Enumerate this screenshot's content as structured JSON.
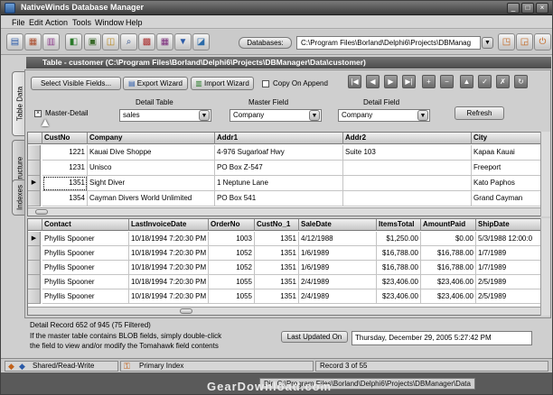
{
  "window": {
    "title": "NativeWinds Database Manager"
  },
  "menu": [
    "File",
    "Edit",
    "Action",
    "Tools",
    "Window",
    "Help"
  ],
  "toolbar": {
    "databases_label": "Databases:",
    "database_path": "C:\\Program Files\\Borland\\Delphi6\\Projects\\DBManag"
  },
  "table_title": "Table - customer (C:\\Program Files\\Borland\\Delphi6\\Projects\\DBManager\\Data\\customer)",
  "side_tabs": [
    "Table Data",
    "Structure",
    "Indexes"
  ],
  "controls": {
    "select_visible_fields": "Select Visible Fields...",
    "export_wizard": "Export Wizard",
    "import_wizard": "Import Wizard",
    "copy_on_append": "Copy On Append",
    "master_detail": "Master-Detail",
    "detail_table_label": "Detail Table",
    "detail_table_value": "sales",
    "master_field_label": "Master Field",
    "master_field_value": "Company",
    "detail_field_label": "Detail Field",
    "detail_field_value": "Company",
    "refresh": "Refresh"
  },
  "master_grid": {
    "columns": [
      "CustNo",
      "Company",
      "Addr1",
      "Addr2",
      "City"
    ],
    "rows": [
      [
        "1221",
        "Kauai Dive Shoppe",
        "4-976 Sugarloaf Hwy",
        "Suite 103",
        "Kapaa Kauai"
      ],
      [
        "1231",
        "Unisco",
        "PO Box Z-547",
        "",
        "Freeport"
      ],
      [
        "1351",
        "Sight Diver",
        "1 Neptune Lane",
        "",
        "Kato Paphos"
      ],
      [
        "1354",
        "Cayman Divers World Unlimited",
        "PO Box 541",
        "",
        "Grand Cayman"
      ]
    ]
  },
  "detail_grid": {
    "columns": [
      "Contact",
      "LastInvoiceDate",
      "OrderNo",
      "CustNo_1",
      "SaleDate",
      "ItemsTotal",
      "AmountPaid",
      "ShipDate"
    ],
    "rows": [
      [
        "Phyllis Spooner",
        "10/18/1994 7:20:30 PM",
        "1003",
        "1351",
        "4/12/1988",
        "$1,250.00",
        "$0.00",
        "5/3/1988 12:00:0"
      ],
      [
        "Phyllis Spooner",
        "10/18/1994 7:20:30 PM",
        "1052",
        "1351",
        "1/6/1989",
        "$16,788.00",
        "$16,788.00",
        "1/7/1989"
      ],
      [
        "Phyllis Spooner",
        "10/18/1994 7:20:30 PM",
        "1052",
        "1351",
        "1/6/1989",
        "$16,788.00",
        "$16,788.00",
        "1/7/1989"
      ],
      [
        "Phyllis Spooner",
        "10/18/1994 7:20:30 PM",
        "1055",
        "1351",
        "2/4/1989",
        "$23,406.00",
        "$23,406.00",
        "2/5/1989"
      ],
      [
        "Phyllis Spooner",
        "10/18/1994 7:20:30 PM",
        "1055",
        "1351",
        "2/4/1989",
        "$23,406.00",
        "$23,406.00",
        "2/5/1989"
      ]
    ]
  },
  "footer": {
    "detail_record": "Detail Record 652 of 945 (75 Filtered)",
    "blob_note_1": "If the master table contains BLOB fields, simply double-click",
    "blob_note_2": "the field to view and/or modify the Tomahawk field contents",
    "last_updated_label": "Last Updated On",
    "last_updated_value": "Thursday, December 29, 2005 5:27:42 PM"
  },
  "status": {
    "mode": "Shared/Read-Write",
    "index": "Primary Index",
    "record": "Record 3 of 55"
  },
  "bottom_path": "Dir: C:\\Program Files\\Borland\\Delphi6\\Projects\\DBManager\\Data",
  "watermark": "GearDownload.com"
}
